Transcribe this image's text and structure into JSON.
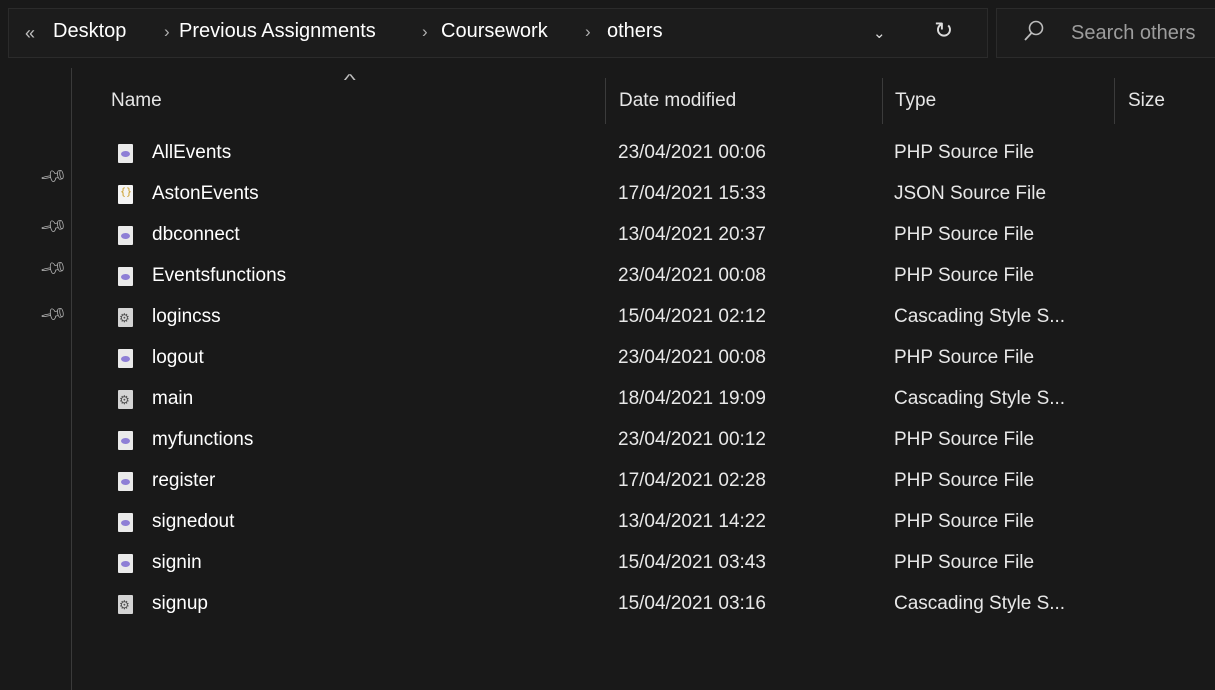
{
  "address_bar": {
    "overflow": "«",
    "crumbs": [
      "Desktop",
      "Previous Assignments",
      "Coursework",
      "others"
    ],
    "separator": "›",
    "dropdown": "⌄",
    "refresh": "↻"
  },
  "search": {
    "placeholder": "Search others"
  },
  "columns": {
    "name": "Name",
    "date": "Date modified",
    "type": "Type",
    "size": "Size"
  },
  "files": [
    {
      "name": "AllEvents",
      "date": "23/04/2021 00:06",
      "type": "PHP Source File",
      "icon": "php-file-icon"
    },
    {
      "name": "AstonEvents",
      "date": "17/04/2021 15:33",
      "type": "JSON Source File",
      "icon": "json-file-icon"
    },
    {
      "name": "dbconnect",
      "date": "13/04/2021 20:37",
      "type": "PHP Source File",
      "icon": "php-file-icon"
    },
    {
      "name": "Eventsfunctions",
      "date": "23/04/2021 00:08",
      "type": "PHP Source File",
      "icon": "php-file-icon"
    },
    {
      "name": "logincss",
      "date": "15/04/2021 02:12",
      "type": "Cascading Style S...",
      "icon": "css-file-icon"
    },
    {
      "name": "logout",
      "date": "23/04/2021 00:08",
      "type": "PHP Source File",
      "icon": "php-file-icon"
    },
    {
      "name": "main",
      "date": "18/04/2021 19:09",
      "type": "Cascading Style S...",
      "icon": "css-file-icon"
    },
    {
      "name": "myfunctions",
      "date": "23/04/2021 00:12",
      "type": "PHP Source File",
      "icon": "php-file-icon"
    },
    {
      "name": "register",
      "date": "17/04/2021 02:28",
      "type": "PHP Source File",
      "icon": "php-file-icon"
    },
    {
      "name": "signedout",
      "date": "13/04/2021 14:22",
      "type": "PHP Source File",
      "icon": "php-file-icon"
    },
    {
      "name": "signin",
      "date": "15/04/2021 03:43",
      "type": "PHP Source File",
      "icon": "php-file-icon"
    },
    {
      "name": "signup",
      "date": "15/04/2021 03:16",
      "type": "Cascading Style S...",
      "icon": "css-file-icon"
    }
  ],
  "pins": [
    "pin-icon",
    "pin-icon",
    "pin-icon",
    "pin-icon"
  ],
  "colors": {
    "background": "#191919",
    "text": "#ffffff",
    "php_icon": "#8e7fd6",
    "json_icon": "#c99a1e"
  }
}
